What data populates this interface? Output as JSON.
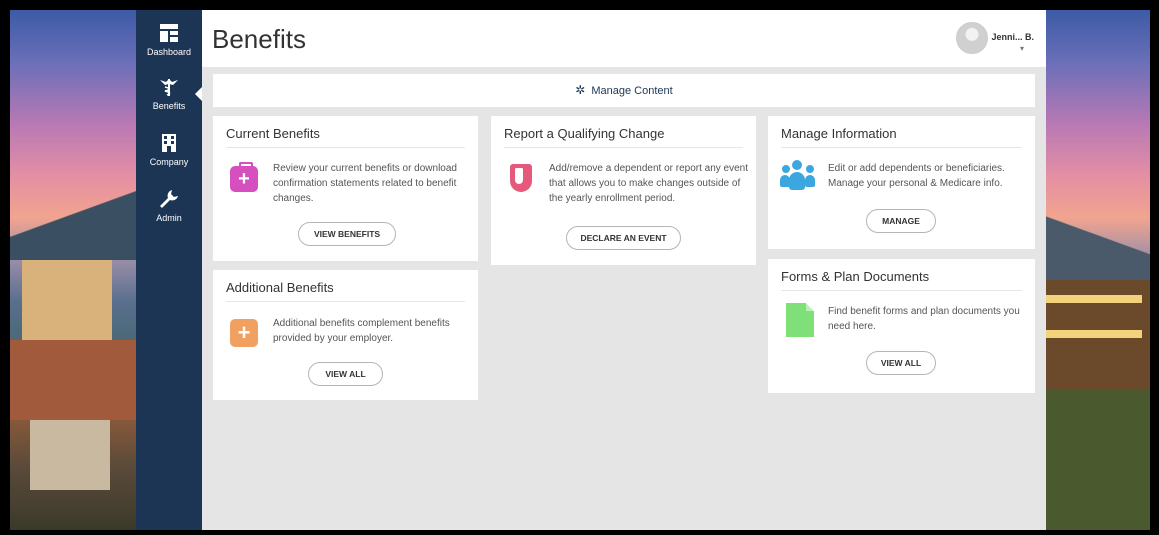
{
  "sidebar": {
    "items": [
      {
        "label": "Dashboard",
        "icon": "dashboard-icon"
      },
      {
        "label": "Benefits",
        "icon": "caduceus-icon"
      },
      {
        "label": "Company",
        "icon": "building-icon"
      },
      {
        "label": "Admin",
        "icon": "wrench-icon"
      }
    ]
  },
  "header": {
    "title": "Benefits",
    "user_name": "Jenni... B."
  },
  "manage_bar": {
    "label": "Manage Content"
  },
  "cards": {
    "current_benefits": {
      "title": "Current Benefits",
      "desc": "Review your current benefits or download confirmation statements related to benefit changes.",
      "button": "VIEW BENEFITS"
    },
    "qualifying_change": {
      "title": "Report a Qualifying Change",
      "desc": "Add/remove a dependent or report any event that allows you to make changes outside of the yearly enrollment period.",
      "button": "DECLARE AN EVENT"
    },
    "manage_information": {
      "title": "Manage Information",
      "desc": "Edit or add dependents or beneficiaries. Manage your personal & Medicare info.",
      "button": "MANAGE"
    },
    "additional_benefits": {
      "title": "Additional Benefits",
      "desc": "Additional benefits complement benefits provided by your employer.",
      "button": "VIEW ALL"
    },
    "forms_plan_documents": {
      "title": "Forms & Plan Documents",
      "desc": "Find benefit forms and plan documents you need here.",
      "button": "VIEW ALL"
    }
  },
  "colors": {
    "sidebar": "#1c3554",
    "background": "#e5e5e5",
    "kit_icon": "#d64fbf",
    "shield_icon": "#e55a7a",
    "plus_icon": "#f0a060",
    "people_icon": "#3aa7e0",
    "doc_icon": "#7fe07a"
  }
}
